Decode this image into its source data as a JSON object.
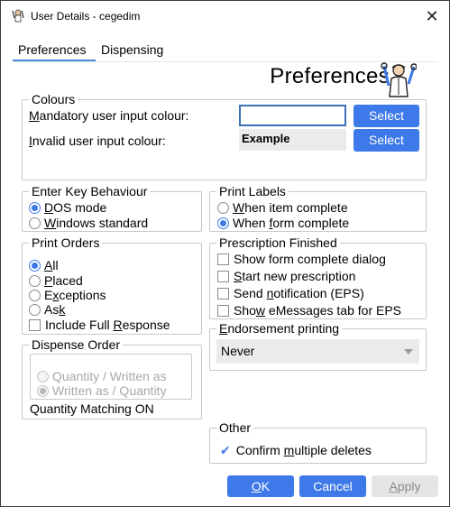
{
  "window": {
    "title": "User Details - cegedim",
    "close_icon": "close-icon"
  },
  "tabs": [
    {
      "label": "Preferences",
      "active": true
    },
    {
      "label": "Dispensing",
      "active": false
    }
  ],
  "header": {
    "title": "Preferences",
    "icon": "user-preferences-icon"
  },
  "colours": {
    "legend": "Colours",
    "mandatory_label_pre": "",
    "mandatory_label_u": "M",
    "mandatory_label_post": "andatory user input colour:",
    "mandatory_value": "",
    "mandatory_select": "Select",
    "invalid_label_pre": "",
    "invalid_label_u": "I",
    "invalid_label_post": "nvalid user input colour:",
    "invalid_example": "Example",
    "invalid_select": "Select"
  },
  "enter_key": {
    "legend": "Enter Key Behaviour",
    "options": [
      {
        "pre": "",
        "u": "D",
        "post": "OS mode",
        "selected": true
      },
      {
        "pre": "",
        "u": "W",
        "post": "indows standard",
        "selected": false
      }
    ]
  },
  "print_labels": {
    "legend": "Print Labels",
    "options": [
      {
        "pre": "",
        "u": "W",
        "post": "hen item complete",
        "selected": false
      },
      {
        "pre": "When ",
        "u": "f",
        "post": "orm complete",
        "selected": true
      }
    ]
  },
  "print_orders": {
    "legend": "Print Orders",
    "radios": [
      {
        "pre": "",
        "u": "A",
        "post": "ll",
        "selected": true
      },
      {
        "pre": "",
        "u": "P",
        "post": "laced",
        "selected": false
      },
      {
        "pre": "E",
        "u": "x",
        "post": "ceptions",
        "selected": false
      },
      {
        "pre": "As",
        "u": "k",
        "post": "",
        "selected": false
      }
    ],
    "checkbox": {
      "pre": "Include Full ",
      "u": "R",
      "post": "esponse",
      "checked": false
    }
  },
  "prescription_finished": {
    "legend": "Prescription Finished",
    "checks": [
      {
        "pre": "Show form complete dialo",
        "u": "g",
        "post": "",
        "checked": false
      },
      {
        "pre": "",
        "u": "S",
        "post": "tart new prescription",
        "checked": false
      },
      {
        "pre": "Send ",
        "u": "n",
        "post": "otification (EPS)",
        "checked": false
      },
      {
        "pre": "Sho",
        "u": "w",
        "post": " eMessages tab for EPS",
        "checked": false
      }
    ]
  },
  "dispense_order": {
    "legend": "Dispense Order",
    "options": [
      {
        "label": "Quantity / Written as",
        "selected": false
      },
      {
        "label": "Written as / Quantity",
        "selected": true
      }
    ],
    "matching": "Quantity Matching ON"
  },
  "endorsement": {
    "legend_pre": "",
    "legend_u": "E",
    "legend_post": "ndorsement printing",
    "value": "Never"
  },
  "other": {
    "legend": "Other",
    "confirm_pre": "Confirm ",
    "confirm_u": "m",
    "confirm_post": "ultiple deletes",
    "checked": true
  },
  "footer": {
    "ok_u": "O",
    "ok_post": "K",
    "cancel": "Cancel",
    "apply_u": "A",
    "apply_post": "pply"
  },
  "colors": {
    "accent": "#3d79e8",
    "border": "#c8c8c8",
    "disabled": "#a8a8a8"
  }
}
